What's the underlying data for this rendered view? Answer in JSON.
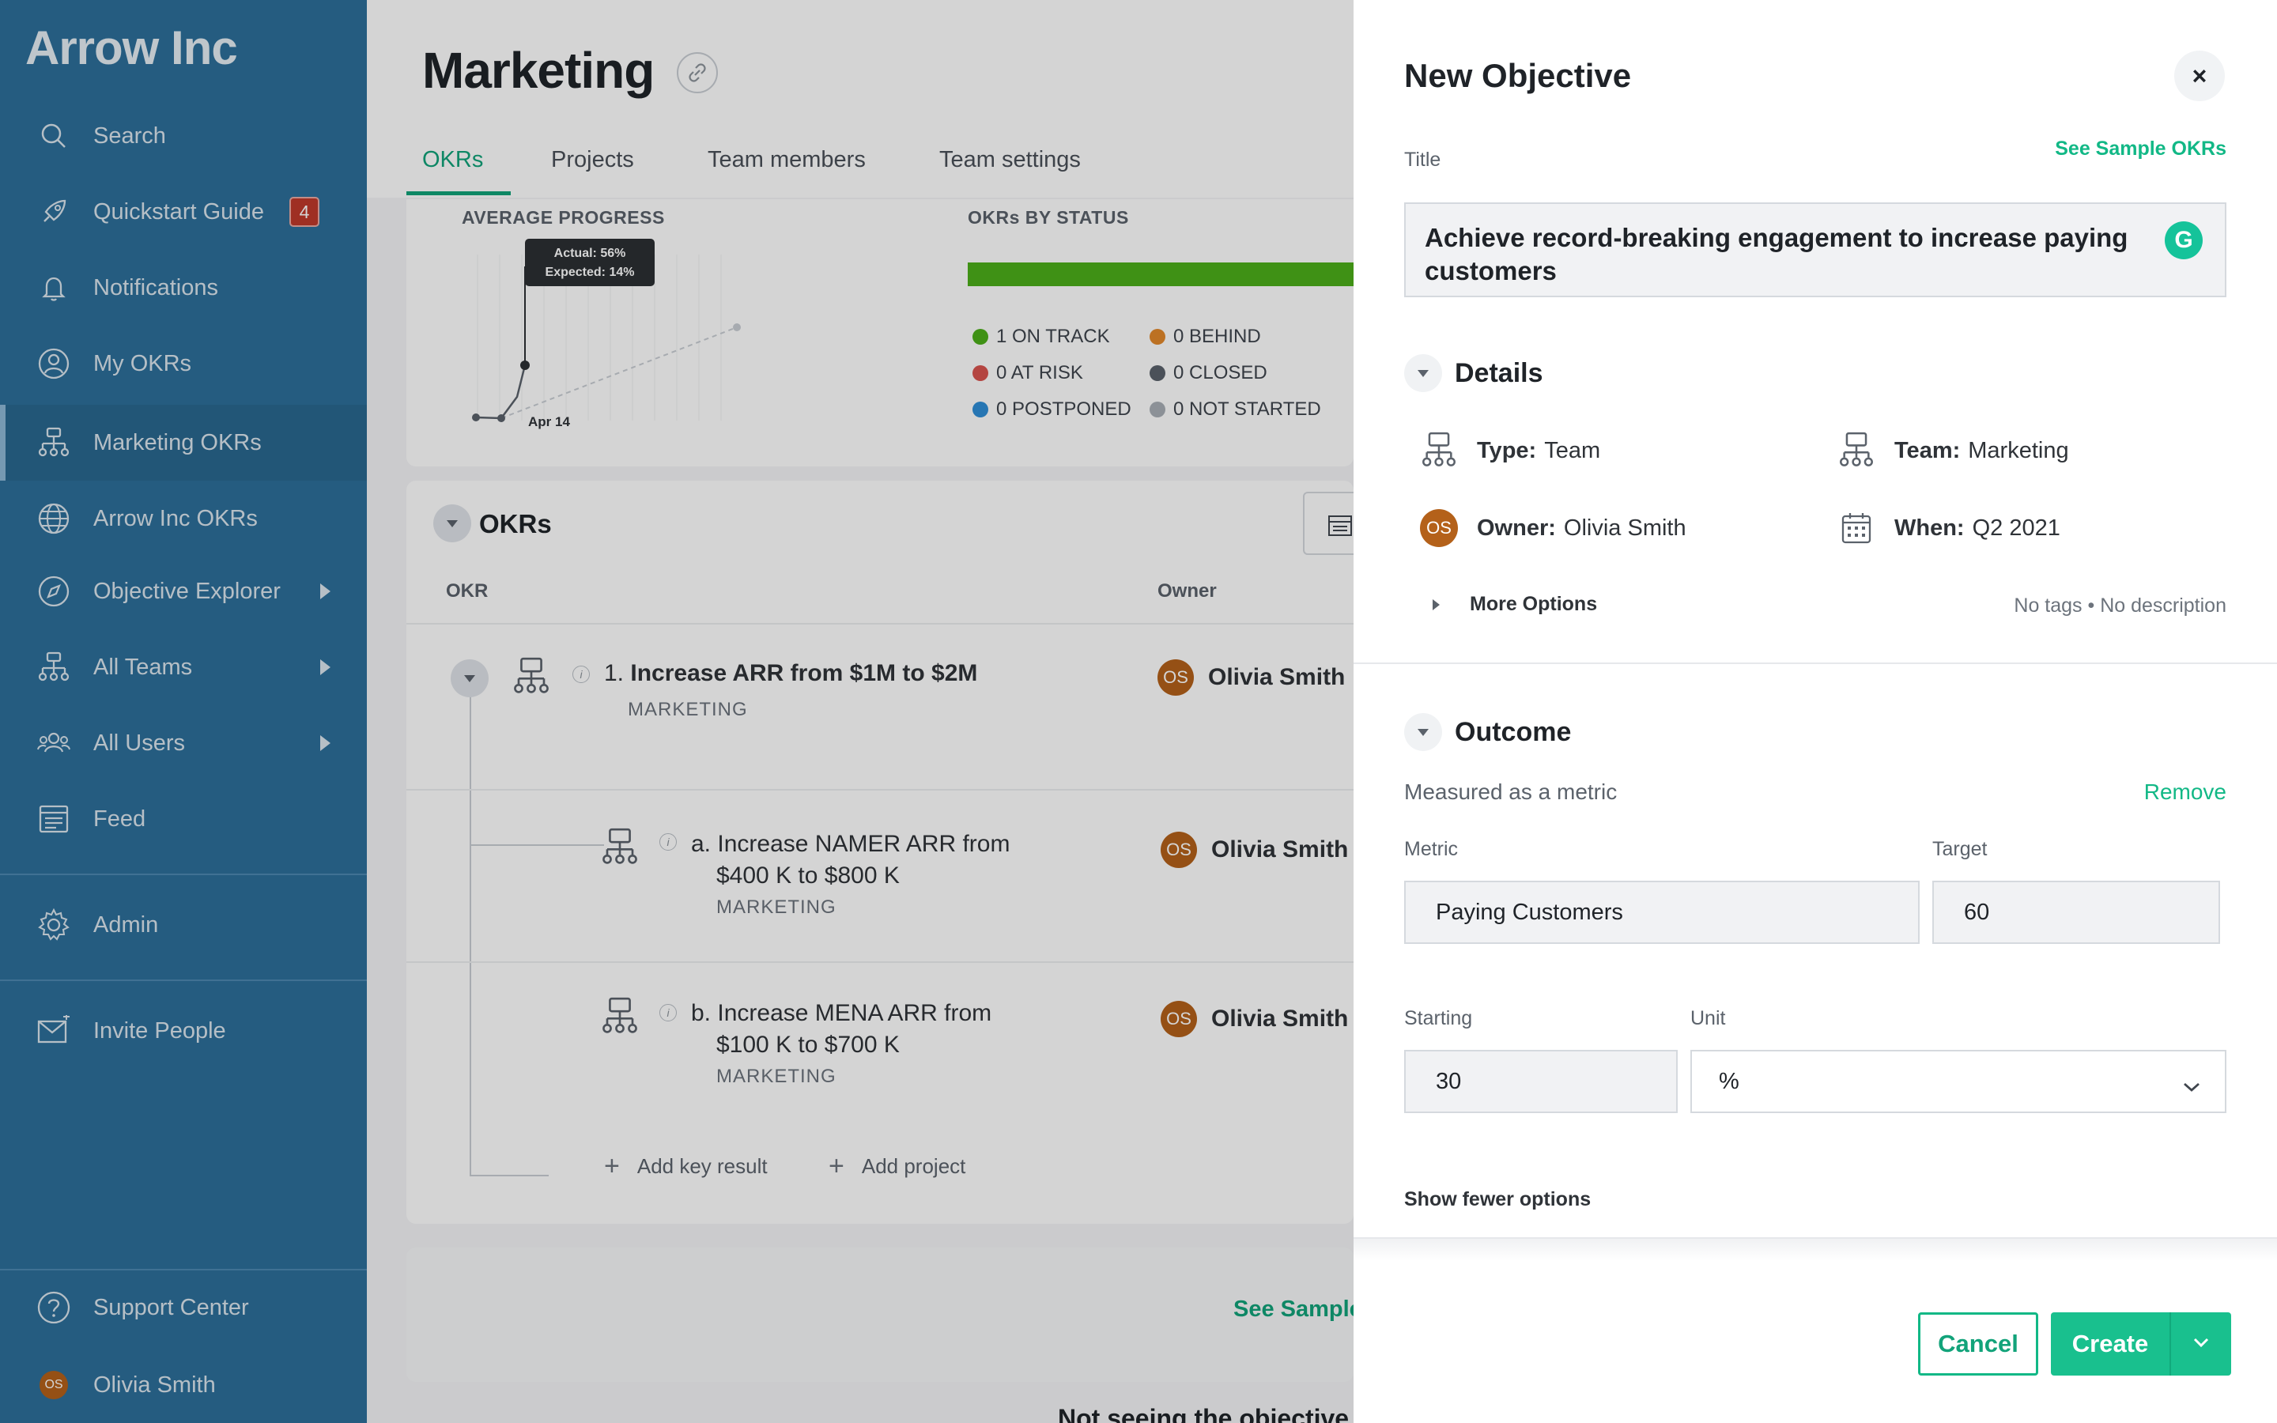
{
  "sidebar": {
    "brand": "Arrow Inc",
    "items": [
      {
        "label": "Search",
        "icon": "search-icon"
      },
      {
        "label": "Quickstart Guide",
        "icon": "rocket-icon",
        "badge": "4"
      },
      {
        "label": "Notifications",
        "icon": "bell-icon"
      },
      {
        "label": "My OKRs",
        "icon": "user-circle-icon"
      },
      {
        "label": "Marketing OKRs",
        "icon": "org-chart-icon",
        "active": true
      },
      {
        "label": "Arrow Inc OKRs",
        "icon": "globe-icon"
      },
      {
        "label": "Objective Explorer",
        "icon": "compass-icon"
      },
      {
        "label": "All Teams",
        "icon": "org-chart-icon"
      },
      {
        "label": "All Users",
        "icon": "users-icon"
      },
      {
        "label": "Feed",
        "icon": "feed-icon"
      },
      {
        "label": "Admin",
        "icon": "gear-icon"
      },
      {
        "label": "Invite People",
        "icon": "mail-icon"
      },
      {
        "label": "Support Center",
        "icon": "help-icon"
      },
      {
        "label": "Olivia Smith",
        "icon": "avatar",
        "avatar_initials": "OS"
      }
    ]
  },
  "main": {
    "title": "Marketing",
    "tabs": [
      "OKRs",
      "Projects",
      "Team members",
      "Team settings"
    ],
    "average_progress": {
      "label": "AVERAGE PROGRESS",
      "tooltip_actual": "Actual: 56%",
      "tooltip_expected": "Expected: 14%",
      "date_label": "Apr 14"
    },
    "status": {
      "label": "OKRs BY STATUS",
      "bar_color": "#4caf1a",
      "items": [
        {
          "label": "1 ON TRACK",
          "color": "#4caf1a"
        },
        {
          "label": "0 BEHIND",
          "color": "#e3892b"
        },
        {
          "label": "0 AT RISK",
          "color": "#d9534f"
        },
        {
          "label": "0 CLOSED",
          "color": "#5b626b"
        },
        {
          "label": "0 POSTPONED",
          "color": "#2f8fd8"
        },
        {
          "label": "0 NOT STARTED",
          "color": "#a9afb6"
        }
      ]
    },
    "okrs": {
      "title": "OKRs",
      "col_okr": "OKR",
      "col_owner": "Owner",
      "rows": [
        {
          "num": "1.",
          "title": "Increase ARR from $1M to $2M",
          "team": "MARKETING",
          "owner": "Olivia Smith",
          "initials": "OS"
        },
        {
          "num": "a.",
          "title_line1": "Increase NAMER ARR from",
          "title_line2": "$400 K to $800 K",
          "team": "MARKETING",
          "owner": "Olivia Smith",
          "initials": "OS"
        },
        {
          "num": "b.",
          "title_line1": "Increase MENA ARR from",
          "title_line2": "$100 K to $700 K",
          "team": "MARKETING",
          "owner": "Olivia Smith",
          "initials": "OS"
        }
      ],
      "add_key_result": "Add key result",
      "add_project": "Add project"
    },
    "see_sample": "See Sample",
    "not_seeing": "Not seeing the objective"
  },
  "drawer": {
    "title": "New Objective",
    "close": "×",
    "title_label": "Title",
    "see_sample_okrs": "See Sample OKRs",
    "title_value": "Achieve record-breaking engagement to increase paying customers",
    "details": {
      "heading": "Details",
      "type_key": "Type:",
      "type_val": "Team",
      "team_key": "Team:",
      "team_val": "Marketing",
      "owner_key": "Owner:",
      "owner_val": "Olivia Smith",
      "owner_initials": "OS",
      "when_key": "When:",
      "when_val": "Q2 2021",
      "more_options": "More Options",
      "meta": "No tags • No description"
    },
    "outcome": {
      "heading": "Outcome",
      "measured": "Measured as a metric",
      "remove": "Remove",
      "metric_label": "Metric",
      "metric_value": "Paying Customers",
      "target_label": "Target",
      "target_value": "60",
      "starting_label": "Starting",
      "starting_value": "30",
      "unit_label": "Unit",
      "unit_value": "%",
      "show_fewer": "Show fewer options"
    },
    "buttons": {
      "cancel": "Cancel",
      "create": "Create"
    }
  },
  "colors": {
    "sidebar": "#2d6f9a",
    "accent": "#12b886",
    "avatar": "#b4611a"
  }
}
